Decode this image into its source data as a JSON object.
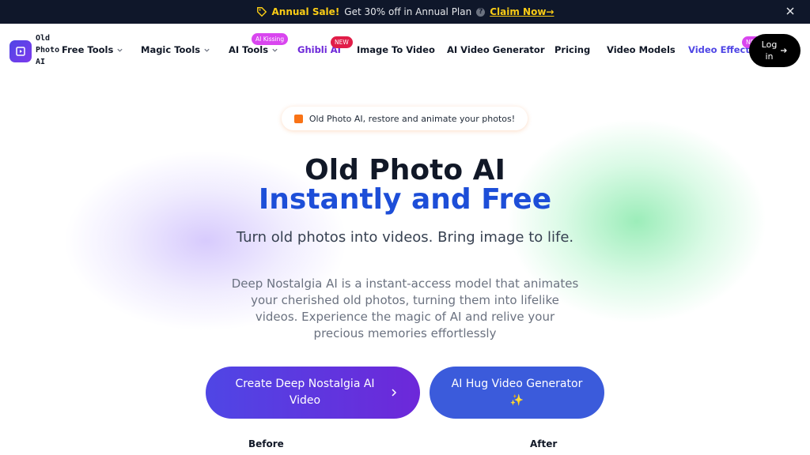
{
  "promo": {
    "sale_label": "Annual Sale!",
    "offer_text": "Get 30% off in Annual Plan",
    "help_glyph": "?",
    "claim_label": "Claim Now→"
  },
  "brand": {
    "line1": "Old",
    "line2": "Photo",
    "line3": "AI"
  },
  "nav": {
    "free_tools": "Free Tools",
    "magic_tools": "Magic Tools",
    "ai_tools": "AI Tools",
    "ai_tools_badge": "AI Kissing",
    "ghibli": "Ghibli AI",
    "ghibli_badge": "NEW",
    "image_to_video": "Image To Video",
    "ai_video_generator": "AI Video Generator",
    "pricing": "Pricing",
    "video_models": "Video Models",
    "video_effects": "Video Effects",
    "video_effects_badge": "NEW",
    "login_line1": "Log",
    "login_line2": "in"
  },
  "hero": {
    "pill_text": "Old Photo AI, restore and animate your photos!",
    "title_line1": "Old Photo AI",
    "title_line2": "Instantly and Free",
    "subtitle": "Turn old photos into videos. Bring image to life.",
    "description": "Deep Nostalgia AI is a instant-access model that animates your cherished old photos, turning them into lifelike videos. Experience the magic of AI and relive your precious memories effortlessly",
    "primary_button_line1": "Create Deep Nostalgia AI",
    "primary_button_line2": "Video",
    "secondary_button_line1": "AI Hug Video Generator",
    "secondary_button_line2": "✨",
    "before_label": "Before",
    "after_label": "After"
  },
  "colors": {
    "promo_bg": "#0f172a",
    "sale_yellow": "#facc15",
    "accent_blue": "#1d4ed8",
    "ghibli_purple": "#6d28d9",
    "badge_pink": "#d946ef",
    "badge_red": "#e11d48",
    "primary_button": "#4f46e5",
    "secondary_button": "#3b5bdb"
  },
  "icons": {
    "promo": "tag-icon",
    "close": "close-icon",
    "logo": "video-icon",
    "chevron": "chevron-down-icon",
    "login": "arrow-right-icon",
    "pill": "image-icon",
    "primary_button": "chevron-right-icon"
  }
}
